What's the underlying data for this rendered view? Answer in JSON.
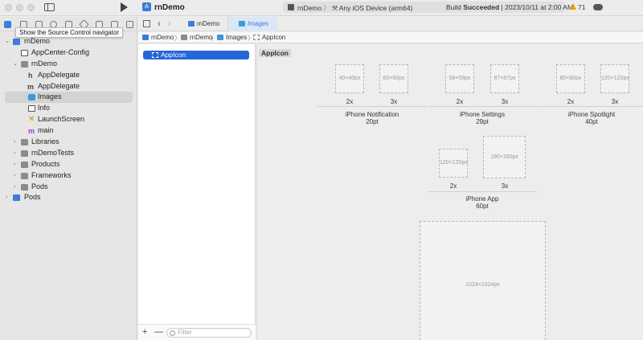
{
  "toolbar": {
    "project_title": "rnDemo",
    "scheme_name": "rnDemo",
    "destination": "Any iOS Device (arm64)",
    "build_prefix": "Build",
    "build_result": "Succeeded",
    "build_timestamp": "| 2023/10/11 at 2:00 AM",
    "warning_count": "71"
  },
  "navigator": {
    "tooltip": "Show the Source Control navigator",
    "items": [
      {
        "label": "rnDemo"
      },
      {
        "label": "AppCenter-Config"
      },
      {
        "label": "rnDemo"
      },
      {
        "label": "AppDelegate"
      },
      {
        "label": "AppDelegate"
      },
      {
        "label": "Images"
      },
      {
        "label": "Info"
      },
      {
        "label": "LaunchScreen"
      },
      {
        "label": "main"
      },
      {
        "label": "Libraries"
      },
      {
        "label": "rnDemoTests"
      },
      {
        "label": "Products"
      },
      {
        "label": "Frameworks"
      },
      {
        "label": "Pods"
      },
      {
        "label": "Pods"
      }
    ]
  },
  "editor": {
    "tabs": [
      {
        "label": "rnDemo"
      },
      {
        "label": "Images"
      }
    ],
    "jumpbar": [
      "rnDemo",
      "rnDemo",
      "Images",
      "AppIcon"
    ]
  },
  "asset_list": {
    "selected_item": "AppIcon",
    "filter_placeholder": "Filter"
  },
  "canvas": {
    "title": "AppIcon",
    "groups": [
      {
        "name": "iPhone Notification",
        "size": "20pt",
        "slots": [
          {
            "px": "40×40px",
            "scale": "2x"
          },
          {
            "px": "60×60px",
            "scale": "3x"
          }
        ]
      },
      {
        "name": "iPhone Settings",
        "size": "29pt",
        "slots": [
          {
            "px": "58×58px",
            "scale": "2x"
          },
          {
            "px": "87×87px",
            "scale": "3x"
          }
        ]
      },
      {
        "name": "iPhone Spotlight",
        "size": "40pt",
        "slots": [
          {
            "px": "80×80px",
            "scale": "2x"
          },
          {
            "px": "120×120px",
            "scale": "3x"
          }
        ]
      },
      {
        "name": "iPhone App",
        "size": "60pt",
        "slots": [
          {
            "px": "120×120px",
            "scale": "2x"
          },
          {
            "px": "180×180px",
            "scale": "3x"
          }
        ]
      }
    ],
    "marketing_slot": "1024×1024px"
  }
}
